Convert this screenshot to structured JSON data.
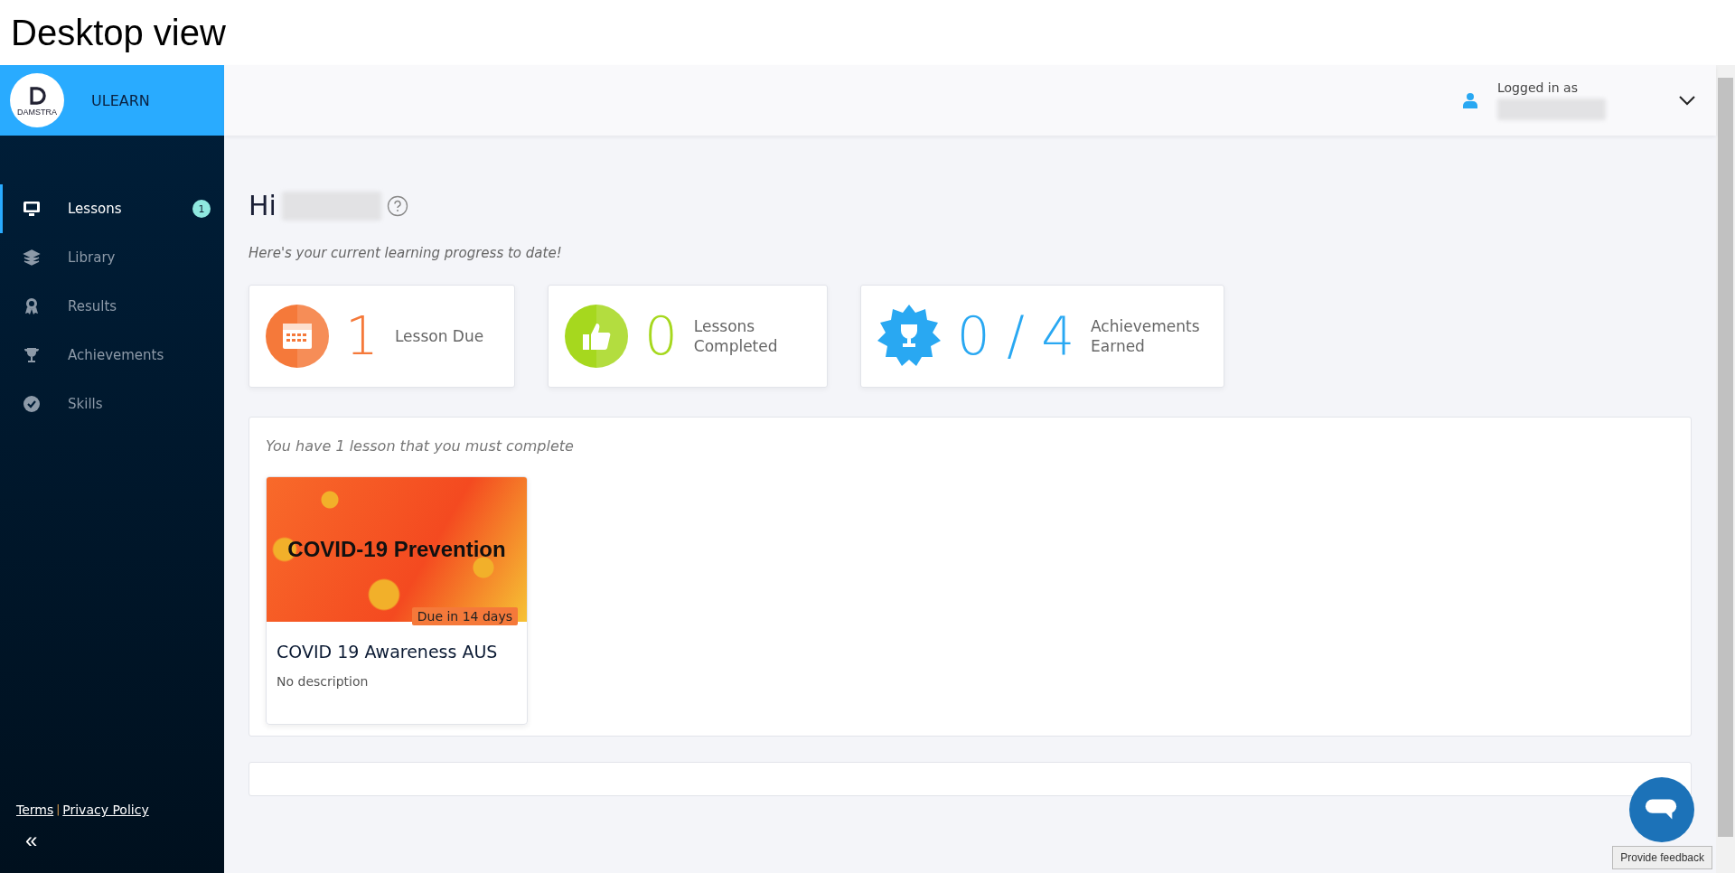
{
  "page_title": "Desktop view",
  "brand": {
    "logo_text": "DAMSTRA",
    "name": "ULEARN"
  },
  "sidebar": {
    "items": [
      {
        "label": "Lessons",
        "kind": "monitor",
        "selected": true,
        "badge": "1"
      },
      {
        "label": "Library",
        "kind": "layers",
        "selected": false
      },
      {
        "label": "Results",
        "kind": "ribbon",
        "selected": false
      },
      {
        "label": "Achievements",
        "kind": "trophy",
        "selected": false
      },
      {
        "label": "Skills",
        "kind": "check",
        "selected": false
      }
    ],
    "footer_links": [
      "Terms",
      "Privacy Policy"
    ],
    "separator": "|",
    "collapse": "«"
  },
  "header": {
    "logged_in_label": "Logged in as"
  },
  "greeting": {
    "hi": "Hi",
    "subtitle": "Here's your current learning progress to date!"
  },
  "stats": [
    {
      "kind": "calendar",
      "value": "1",
      "label": "Lesson Due",
      "color": "#f5793a"
    },
    {
      "kind": "thumb",
      "value": "0",
      "label": "Lessons Completed",
      "color": "#a6d81e"
    },
    {
      "kind": "trophy",
      "value": "0 / 4",
      "label": "Achievements Earned",
      "color": "#29a8f2"
    }
  ],
  "lessons_panel": {
    "intro": "You have 1 lesson that you must complete",
    "lessons": [
      {
        "image_text": "COVID-19 Prevention",
        "due": "Due in 14 days",
        "title": "COVID 19 Awareness AUS",
        "description": "No description"
      }
    ]
  },
  "feedback": {
    "label": "Provide feedback"
  }
}
